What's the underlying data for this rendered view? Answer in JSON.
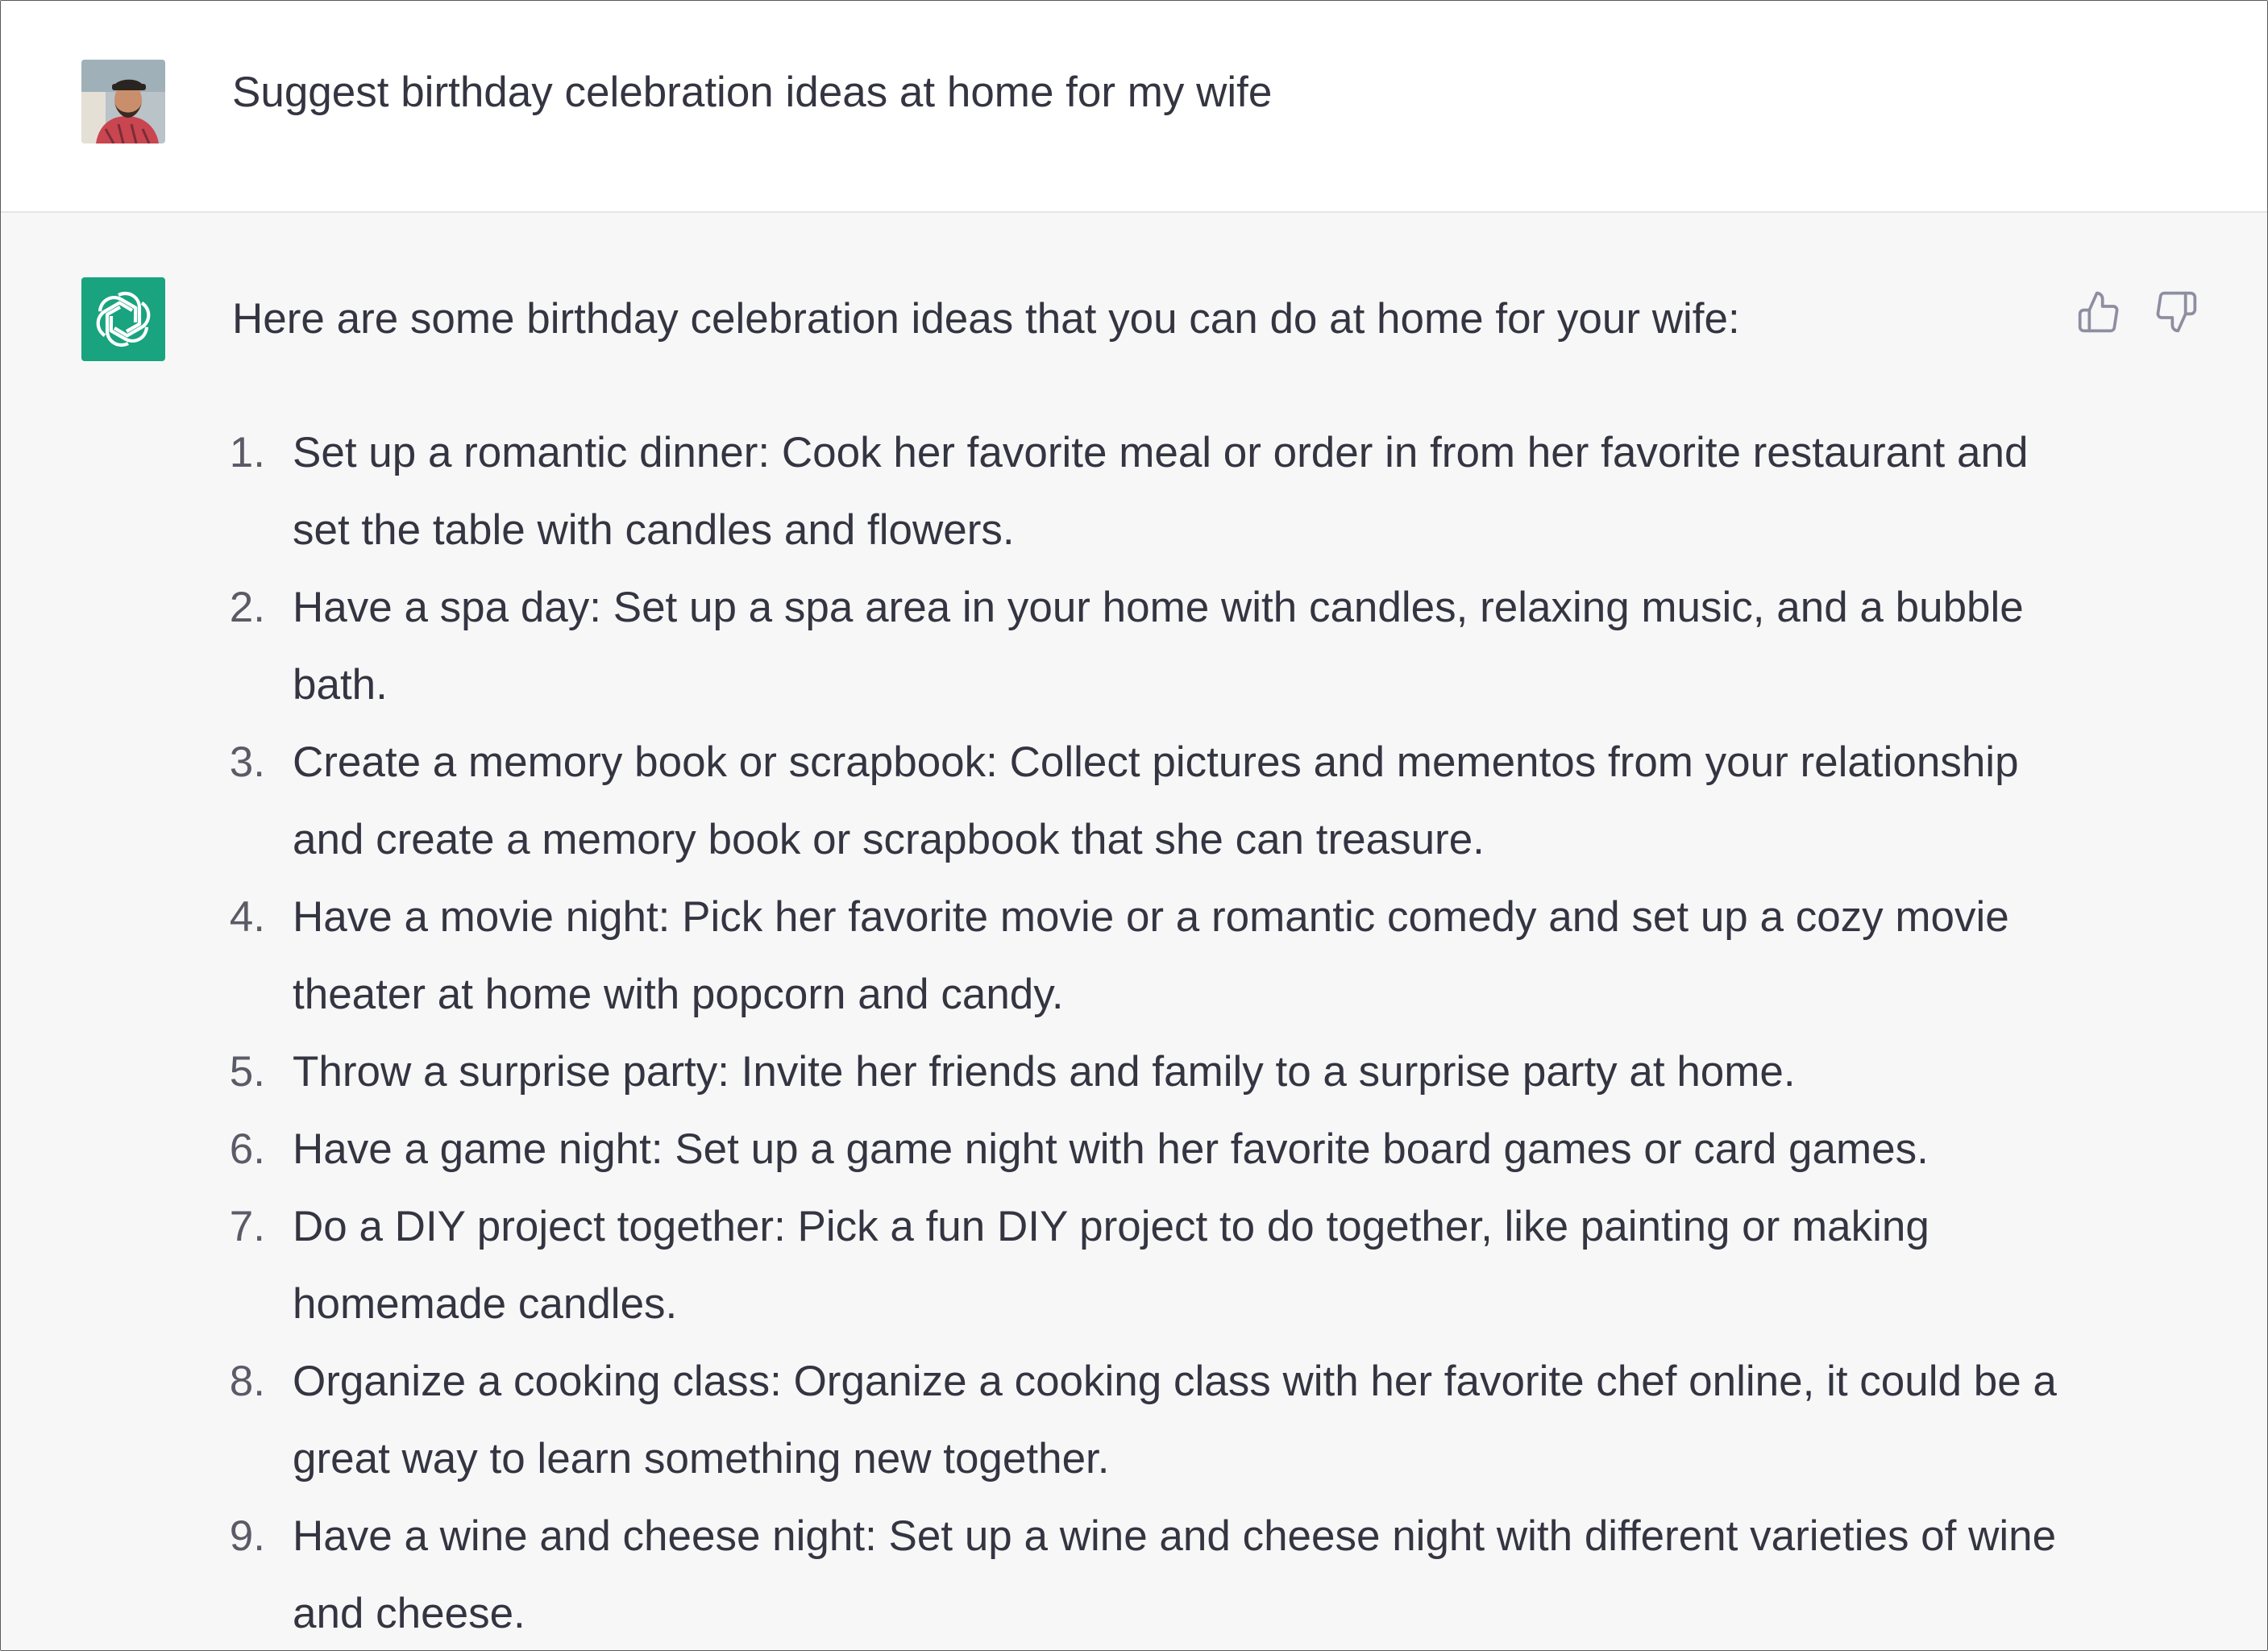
{
  "user": {
    "avatar_icon": "user-photo-avatar",
    "message": "Suggest birthday celebration ideas at home for my wife"
  },
  "assistant": {
    "avatar_icon": "openai-logo-icon",
    "intro": "Here are some birthday celebration ideas that you can do at home for your wife:",
    "items": [
      {
        "num": "1.",
        "text": "Set up a romantic dinner: Cook her favorite meal or order in from her favorite restaurant and set the table with candles and flowers."
      },
      {
        "num": "2.",
        "text": "Have a spa day: Set up a spa area in your home with candles, relaxing music, and a bubble bath."
      },
      {
        "num": "3.",
        "text": "Create a memory book or scrapbook: Collect pictures and mementos from your relationship and create a memory book or scrapbook that she can treasure."
      },
      {
        "num": "4.",
        "text": "Have a movie night: Pick her favorite movie or a romantic comedy and set up a cozy movie theater at home with popcorn and candy."
      },
      {
        "num": "5.",
        "text": "Throw a surprise party: Invite her friends and family to a surprise party at home."
      },
      {
        "num": "6.",
        "text": "Have a game night: Set up a game night with her favorite board games or card games."
      },
      {
        "num": "7.",
        "text": "Do a DIY project together: Pick a fun DIY project to do together, like painting or making homemade candles."
      },
      {
        "num": "8.",
        "text": "Organize a cooking class: Organize a cooking class with her favorite chef online, it could be a great way to learn something new together."
      },
      {
        "num": "9.",
        "text": "Have a wine and cheese night: Set up a wine and cheese night with different varieties of wine and cheese."
      }
    ],
    "feedback_icons": [
      "thumbs-up-icon",
      "thumbs-down-icon"
    ]
  },
  "colors": {
    "assistant_bg": "#f7f7f8",
    "logo_bg": "#19a37f",
    "text": "#343541"
  }
}
